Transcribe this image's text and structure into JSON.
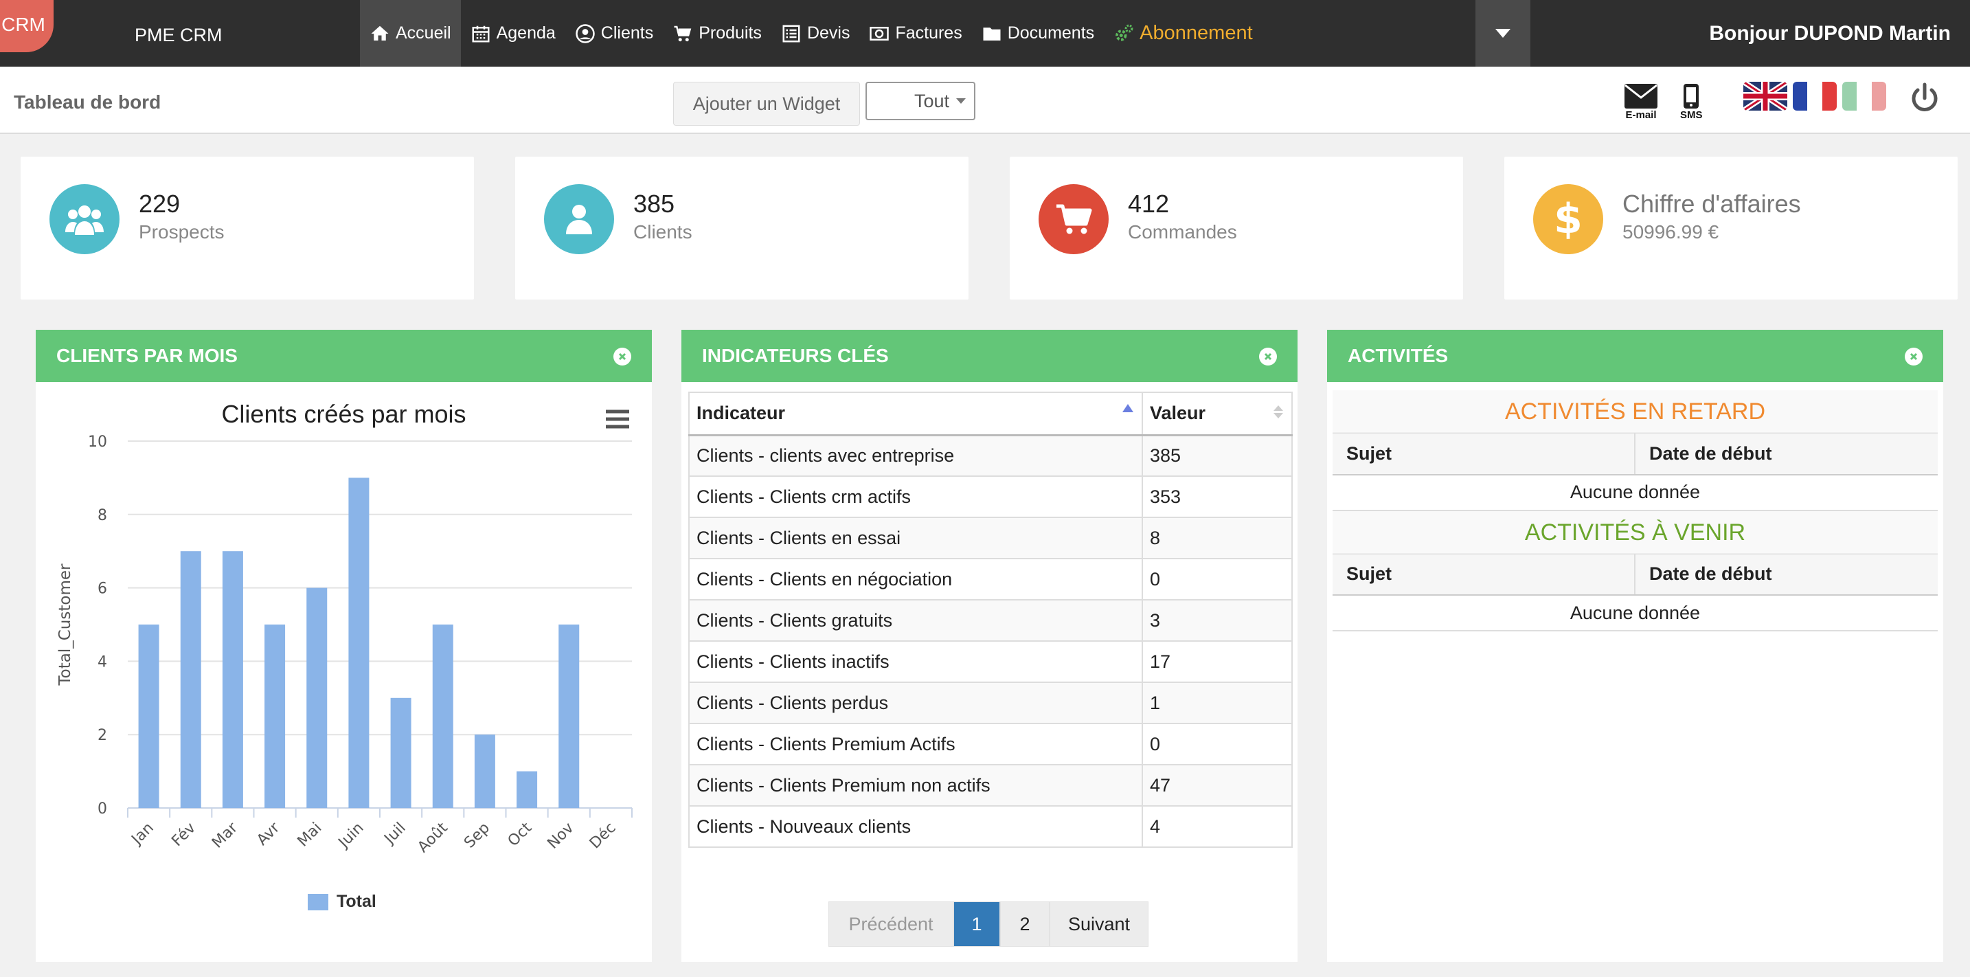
{
  "navbar": {
    "logo": "CRM",
    "brand": "PME CRM",
    "items": [
      {
        "label": "Accueil",
        "icon": "home-icon"
      },
      {
        "label": "Agenda",
        "icon": "calendar-icon"
      },
      {
        "label": "Clients",
        "icon": "user-circle-icon"
      },
      {
        "label": "Produits",
        "icon": "cart-icon"
      },
      {
        "label": "Devis",
        "icon": "list-doc-icon"
      },
      {
        "label": "Factures",
        "icon": "money-icon"
      },
      {
        "label": "Documents",
        "icon": "folder-icon"
      }
    ],
    "subscription": "Abonnement",
    "greeting": "Bonjour DUPOND Martin"
  },
  "subheader": {
    "title": "Tableau de bord",
    "add_widget": "Ajouter un Widget",
    "filter_value": "Tout",
    "email_label": "E-mail",
    "sms_label": "SMS"
  },
  "stats": [
    {
      "value": "229",
      "label": "Prospects",
      "color": "#4fbcca"
    },
    {
      "value": "385",
      "label": "Clients",
      "color": "#4fbcca"
    },
    {
      "value": "412",
      "label": "Commandes",
      "color": "#dd4b39"
    },
    {
      "value": "Chiffre d'affaires",
      "label": "50996.99 €",
      "color": "#f4b63f"
    }
  ],
  "panels": {
    "clients_month": "CLIENTS PAR MOIS",
    "indicators": "INDICATEURS CLÉS",
    "activities": "ACTIVITÉS"
  },
  "chart_data": {
    "type": "bar",
    "title": "Clients créés par mois",
    "xlabel": "",
    "ylabel": "Total_Customer",
    "categories": [
      "Jan",
      "Fév",
      "Mar",
      "Avr",
      "Mai",
      "Juin",
      "Juil",
      "Août",
      "Sep",
      "Oct",
      "Nov",
      "Déc"
    ],
    "series": [
      {
        "name": "Total",
        "values": [
          5,
          7,
          7,
          5,
          6,
          9,
          3,
          5,
          2,
          1,
          5,
          0
        ]
      }
    ],
    "ylim": [
      0,
      10
    ],
    "yticks": [
      0,
      2,
      4,
      6,
      8,
      10
    ],
    "color": "#8ab4e8",
    "grid": true,
    "legend": "bottom"
  },
  "indicators": {
    "col_indicator": "Indicateur",
    "col_value": "Valeur",
    "rows": [
      {
        "name": "Clients - clients avec entreprise",
        "value": "385"
      },
      {
        "name": "Clients - Clients crm actifs",
        "value": "353"
      },
      {
        "name": "Clients - Clients en essai",
        "value": "8"
      },
      {
        "name": "Clients - Clients en négociation",
        "value": "0"
      },
      {
        "name": "Clients - Clients gratuits",
        "value": "3"
      },
      {
        "name": "Clients - Clients inactifs",
        "value": "17"
      },
      {
        "name": "Clients - Clients perdus",
        "value": "1"
      },
      {
        "name": "Clients - Clients Premium Actifs",
        "value": "0"
      },
      {
        "name": "Clients - Clients Premium non actifs",
        "value": "47"
      },
      {
        "name": "Clients - Nouveaux clients",
        "value": "4"
      }
    ],
    "pager": {
      "prev": "Précédent",
      "pages": [
        "1",
        "2"
      ],
      "current": "1",
      "next": "Suivant"
    }
  },
  "activities": {
    "late_title": "ACTIVITÉS EN RETARD",
    "late_color": "#f08a30",
    "upcoming_title": "ACTIVITÉS À VENIR",
    "upcoming_color": "#6aa52c",
    "col_subject": "Sujet",
    "col_start": "Date de début",
    "empty": "Aucune donnée"
  }
}
